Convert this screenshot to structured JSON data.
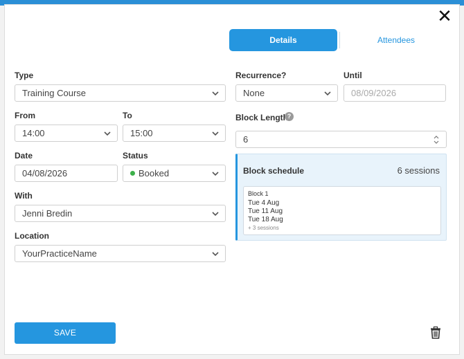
{
  "modal": {
    "close_glyph": "✕"
  },
  "tabs": {
    "details": "Details",
    "attendees": "Attendees"
  },
  "form": {
    "type": {
      "label": "Type",
      "value": "Training Course"
    },
    "from": {
      "label": "From",
      "value": "14:00"
    },
    "to": {
      "label": "To",
      "value": "15:00"
    },
    "date": {
      "label": "Date",
      "value": "04/08/2026"
    },
    "status": {
      "label": "Status",
      "value": "Booked",
      "color": "#3cb04a"
    },
    "with": {
      "label": "With",
      "value": "Jenni Bredin"
    },
    "location": {
      "label": "Location",
      "value": "YourPracticeName"
    },
    "recurrence": {
      "label": "Recurrence?",
      "value": "None"
    },
    "until": {
      "label": "Until",
      "value": "08/09/2026"
    },
    "block_length": {
      "label": "Block Length",
      "help": "?",
      "value": "6"
    }
  },
  "schedule": {
    "title": "Block schedule",
    "count": "6 sessions",
    "block": {
      "name": "Block 1",
      "dates": [
        "Tue 4 Aug",
        "Tue 11 Aug",
        "Tue 18 Aug"
      ],
      "more": "+ 3 sessions"
    }
  },
  "footer": {
    "save_label": "SAVE",
    "delete_icon": "trash-icon"
  },
  "colors": {
    "accent": "#2596df",
    "panel": "#e8f3fb"
  }
}
